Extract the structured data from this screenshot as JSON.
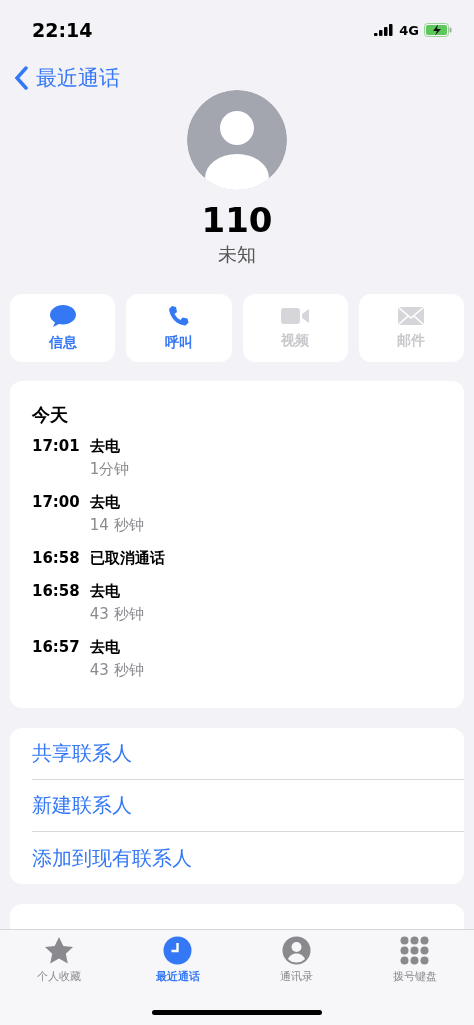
{
  "status_bar": {
    "time": "22:14",
    "network": "4G"
  },
  "nav": {
    "back_label": "最近通话"
  },
  "contact": {
    "number": "110",
    "label": "未知"
  },
  "actions": [
    {
      "kind": "message",
      "label": "信息",
      "disabled": false
    },
    {
      "kind": "call",
      "label": "呼叫",
      "disabled": false
    },
    {
      "kind": "video",
      "label": "视频",
      "disabled": true
    },
    {
      "kind": "mail",
      "label": "邮件",
      "disabled": true
    }
  ],
  "call_log": {
    "date": "今天",
    "entries": [
      {
        "time": "17:01",
        "type": "去电",
        "duration": "1分钟"
      },
      {
        "time": "17:00",
        "type": "去电",
        "duration": "14 秒钟"
      },
      {
        "time": "16:58",
        "type": "已取消通话"
      },
      {
        "time": "16:58",
        "type": "去电",
        "duration": "43 秒钟"
      },
      {
        "time": "16:57",
        "type": "去电",
        "duration": "43 秒钟"
      }
    ]
  },
  "contact_options": [
    "共享联系人",
    "新建联系人",
    "添加到现有联系人"
  ],
  "tab_bar": [
    {
      "kind": "favorites",
      "label": "个人收藏",
      "selected": false
    },
    {
      "kind": "recents",
      "label": "最近通话",
      "selected": true
    },
    {
      "kind": "contacts",
      "label": "通讯录",
      "selected": false
    },
    {
      "kind": "keypad",
      "label": "拨号键盘",
      "selected": false
    }
  ]
}
